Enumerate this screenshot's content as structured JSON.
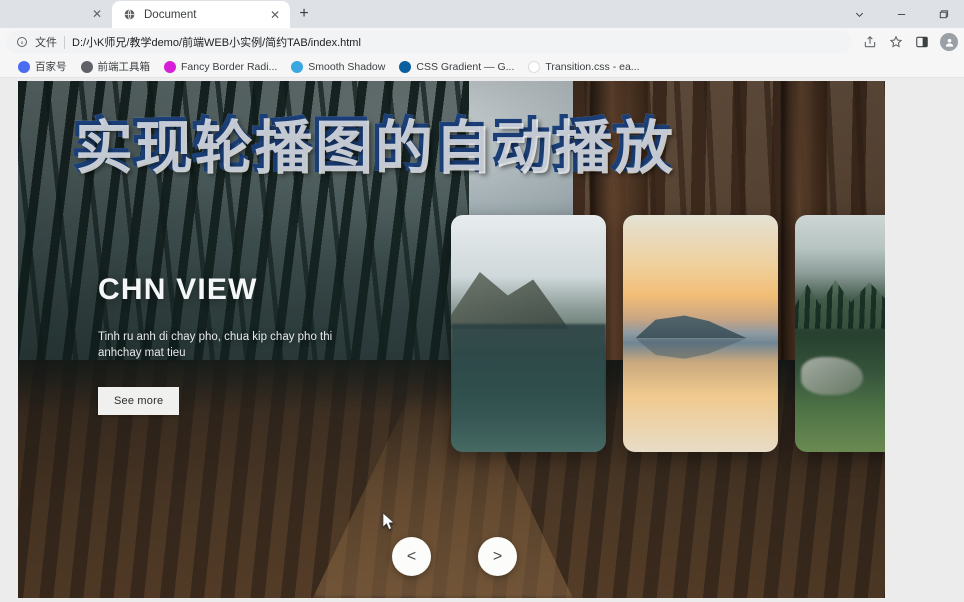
{
  "window": {
    "controls": {
      "chevron_down": "chevron-down",
      "minimize": "minimize",
      "maximize": "maximize"
    }
  },
  "tabstrip": {
    "ghost_tab_close": "✕",
    "active_tab": {
      "title": "Document",
      "favicon": "globe-icon",
      "close": "✕"
    },
    "new_tab": "+"
  },
  "toolbar": {
    "site_info_icon": "info-circle-icon",
    "scheme_label": "文件",
    "url": "D:/小K师兄/教学demo/前端WEB小实例/简约TAB/index.html",
    "actions": [
      {
        "name": "share-icon",
        "label": "share"
      },
      {
        "name": "bookmark-star-icon",
        "label": "bookmark"
      },
      {
        "name": "side-panel-icon",
        "label": "side panel"
      }
    ],
    "profile": {
      "name": "profile-avatar",
      "label": "profile"
    }
  },
  "bookmarks": [
    {
      "label": "百家号",
      "icon": "baidu-icon",
      "color": "#4a6cf0"
    },
    {
      "label": "前端工具箱",
      "icon": "globe-icon",
      "color": "#5f6368"
    },
    {
      "label": "Fancy Border Radi...",
      "icon": "circle-icon",
      "color": "#d61fd6"
    },
    {
      "label": "Smooth Shadow",
      "icon": "circle-icon",
      "color": "#39a7e0"
    },
    {
      "label": "CSS Gradient — G...",
      "icon": "circle-icon",
      "color": "#0a5f9e"
    },
    {
      "label": "Transition.css - ea...",
      "icon": "circle-icon",
      "color": "#d9dde1"
    }
  ],
  "page": {
    "overlay_headline": "实现轮播图的自动播放",
    "hero": {
      "title": "CHN VIEW",
      "description": "Tinh ru anh di chay pho, chua kip chay pho thi anhchay mat tieu",
      "cta_label": "See more"
    },
    "thumbnails": [
      {
        "name": "thumbnail-misty-mountain-lake"
      },
      {
        "name": "thumbnail-golden-sunset-lake"
      },
      {
        "name": "thumbnail-foggy-forest-hillside"
      }
    ],
    "nav": {
      "prev_label": "<",
      "next_label": ">"
    },
    "colors": {
      "page_background": "#ececec",
      "cta_background": "#f0f0ee",
      "nav_background": "#fcfcfa",
      "headline_stroke": "#1b3f78"
    }
  }
}
